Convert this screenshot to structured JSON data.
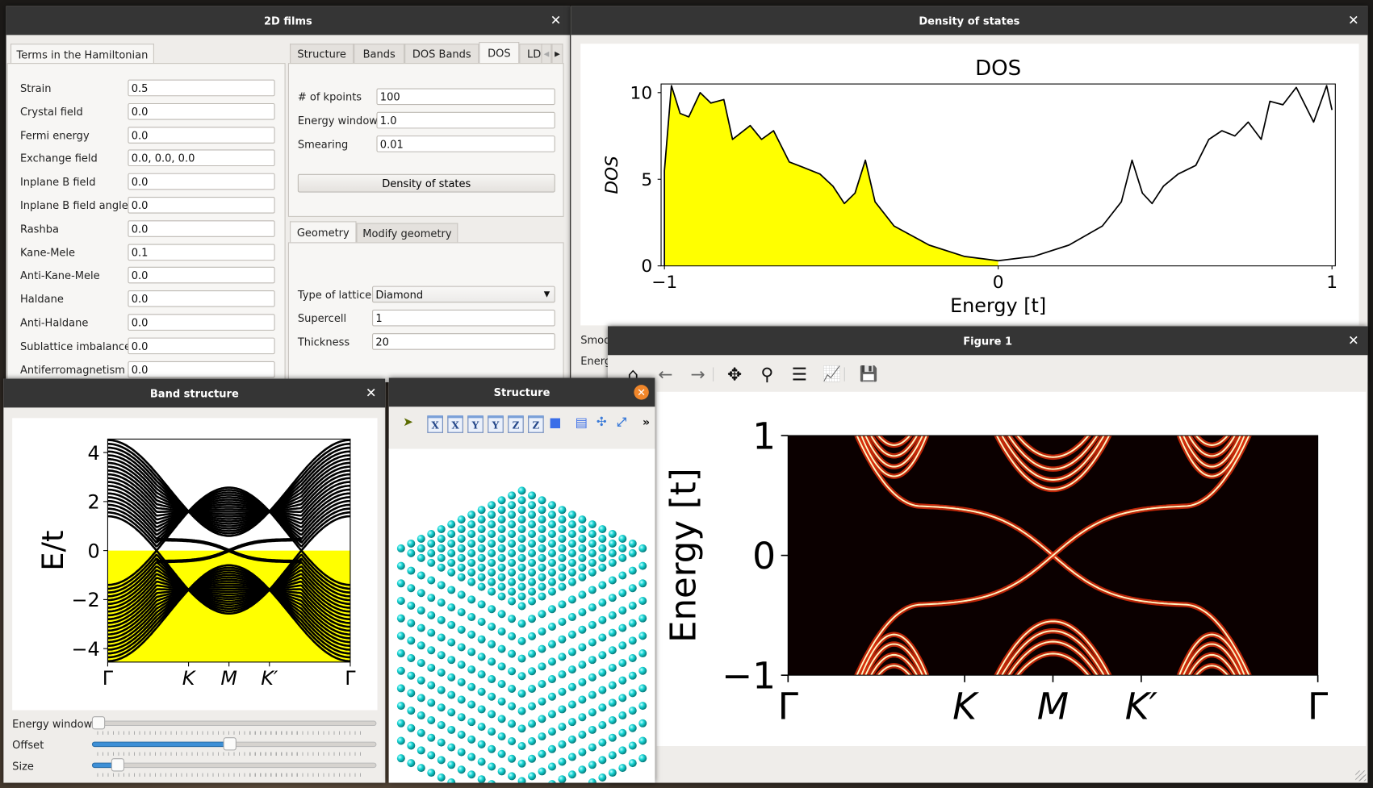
{
  "windows": {
    "films": {
      "title": "2D films",
      "hamiltonian_tab": "Terms in the Hamiltonian",
      "terms": [
        {
          "label": "Strain",
          "value": "0.5"
        },
        {
          "label": "Crystal field",
          "value": "0.0"
        },
        {
          "label": "Fermi energy",
          "value": "0.0"
        },
        {
          "label": "Exchange field",
          "value": "0.0, 0.0, 0.0"
        },
        {
          "label": "Inplane B field",
          "value": "0.0"
        },
        {
          "label": "Inplane B field angle",
          "value": "0.0"
        },
        {
          "label": "Rashba",
          "value": "0.0"
        },
        {
          "label": "Kane-Mele",
          "value": "0.1"
        },
        {
          "label": "Anti-Kane-Mele",
          "value": "0.0"
        },
        {
          "label": "Haldane",
          "value": "0.0"
        },
        {
          "label": "Anti-Haldane",
          "value": "0.0"
        },
        {
          "label": "Sublattice imbalance",
          "value": "0.0"
        },
        {
          "label": "Antiferromagnetism",
          "value": "0.0"
        }
      ],
      "right_tabs": [
        "Structure",
        "Bands",
        "DOS Bands",
        "DOS",
        "LD"
      ],
      "active_right_tab": "DOS",
      "dos_params": [
        {
          "label": "# of kpoints",
          "value": "100"
        },
        {
          "label": "Energy window",
          "value": "1.0"
        },
        {
          "label": "Smearing",
          "value": "0.01"
        }
      ],
      "dos_button": "Density of states",
      "geometry_tabs": [
        "Geometry",
        "Modify geometry"
      ],
      "active_geometry_tab": "Geometry",
      "lattice_label": "Type of lattice",
      "lattice_value": "Diamond",
      "supercell_label": "Supercell",
      "supercell_value": "1",
      "thickness_label": "Thickness",
      "thickness_value": "20"
    },
    "dos": {
      "title": "Density of states",
      "partial_labels": [
        "Smoo",
        "Energ"
      ]
    },
    "figure1": {
      "title": "Figure 1",
      "toolbar": [
        "home-icon",
        "back-arrow-icon",
        "forward-arrow-icon",
        "pan-move-icon",
        "zoom-magnifier-icon",
        "configure-subplots-icon",
        "edit-axes-icon",
        "save-disk-icon"
      ]
    },
    "bands": {
      "title": "Band structure",
      "sliders": [
        {
          "label": "Energy window",
          "value": 0.0
        },
        {
          "label": "Offset",
          "value": 0.48
        },
        {
          "label": "Size",
          "value": 0.07
        }
      ]
    },
    "structure": {
      "title": "Structure",
      "toolbar": [
        "select-pointer-icon",
        "view-x-icon",
        "view-minus-x-icon",
        "view-y-icon",
        "view-minus-y-icon",
        "view-z-icon",
        "view-minus-z-icon",
        "iso-cube-icon",
        "split-view-icon",
        "center-icon",
        "fit-view-icon",
        "more-chevron-icon"
      ],
      "atom_color": "#00d8d8"
    }
  },
  "chart_data": [
    {
      "type": "area",
      "title": "DOS",
      "xlabel": "Energy [t]",
      "ylabel": "DOS",
      "xlim": [
        -1.01,
        1.01
      ],
      "ylim": [
        0,
        10.5
      ],
      "xticks": [
        "−1",
        "0",
        "1"
      ],
      "xtick_values": [
        -1,
        0,
        1
      ],
      "yticks": [
        "0",
        "5",
        "10"
      ],
      "ytick_values": [
        0,
        5,
        10
      ],
      "fill_color": "#ffff00",
      "fill_below": 0,
      "x": [
        -1.0,
        -0.979,
        -0.953,
        -0.927,
        -0.893,
        -0.861,
        -0.822,
        -0.796,
        -0.743,
        -0.709,
        -0.673,
        -0.626,
        -0.586,
        -0.534,
        -0.495,
        -0.461,
        -0.429,
        -0.398,
        -0.369,
        -0.312,
        -0.207,
        -0.102,
        0.0,
        0.107,
        0.212,
        0.312,
        0.369,
        0.401,
        0.432,
        0.461,
        0.495,
        0.539,
        0.592,
        0.631,
        0.67,
        0.709,
        0.749,
        0.788,
        0.814,
        0.853,
        0.893,
        0.945,
        0.984,
        1.0
      ],
      "y": [
        5.5,
        10.4,
        8.8,
        8.6,
        10.0,
        9.4,
        9.6,
        7.3,
        8.1,
        7.3,
        7.8,
        6.0,
        5.7,
        5.3,
        4.6,
        3.6,
        4.2,
        6.1,
        3.7,
        2.3,
        1.2,
        0.55,
        0.3,
        0.55,
        1.2,
        2.3,
        3.7,
        6.1,
        4.2,
        3.6,
        4.6,
        5.3,
        5.8,
        7.3,
        7.8,
        7.5,
        8.3,
        7.3,
        9.5,
        9.3,
        10.3,
        8.3,
        10.4,
        9.0
      ]
    },
    {
      "type": "line",
      "ylabel": "E/t",
      "ylim": [
        -4.55,
        4.55
      ],
      "xticks": [
        "Γ",
        "K",
        "M",
        "K′",
        "Γ"
      ],
      "xtick_positions": [
        0,
        0.3333,
        0.5,
        0.6667,
        1
      ],
      "yticks": [
        "−4",
        "−2",
        "0",
        "2",
        "4"
      ],
      "ytick_values": [
        -4,
        -2,
        0,
        2,
        4
      ],
      "occupied_fill_color": "#ffff00",
      "band_color": "#000000"
    },
    {
      "type": "heatmap",
      "ylabel": "Energy [t]",
      "ylim": [
        -1,
        1
      ],
      "xticks": [
        "Γ",
        "K",
        "M",
        "K′",
        "Γ"
      ],
      "xtick_positions": [
        0,
        0.3333,
        0.5,
        0.6667,
        1
      ],
      "yticks": [
        "−1",
        "0",
        "1"
      ],
      "ytick_values": [
        -1,
        0,
        1
      ],
      "colormap": "hot"
    }
  ]
}
